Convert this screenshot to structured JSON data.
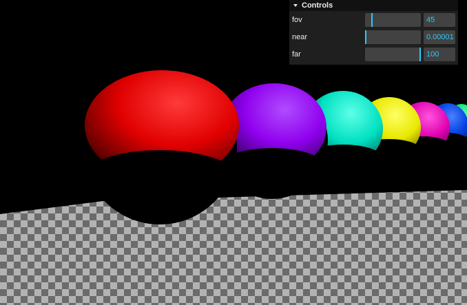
{
  "panel": {
    "title": "Controls",
    "collapse_icon": "chevron-down-icon"
  },
  "controls": [
    {
      "label": "fov",
      "value": "45",
      "fraction": 0.12
    },
    {
      "label": "near",
      "value": "0.00001",
      "fraction": 0.0
    },
    {
      "label": "far",
      "value": "100",
      "fraction": 1.0
    }
  ],
  "colors": {
    "accent": "#2cc9ff",
    "panel_bg": "#1f1f1f",
    "widget_bg": "#424242",
    "background": "#000000",
    "checker_light": "#b3b3b3",
    "checker_dark": "#6b6b6b",
    "spheres": [
      "#ff0000",
      "#9b00ff",
      "#00ffd8",
      "#ffff00",
      "#ff00c8",
      "#0050ff",
      "#00ff80"
    ]
  }
}
